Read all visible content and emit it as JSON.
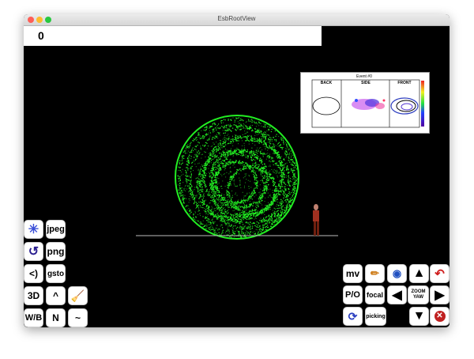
{
  "window": {
    "title": "EsbRootView"
  },
  "counter": {
    "value": "0"
  },
  "inset": {
    "title": "Event #0",
    "labels": {
      "back": "BACK",
      "side": "SIDE",
      "front": "FRONT"
    }
  },
  "left_buttons": {
    "jpeg": "jpeg",
    "png": "png",
    "back": "<)",
    "gsto": "gsto",
    "three_d": "3D",
    "up": "^",
    "wb": "W/B",
    "n": "N",
    "tilde": "~"
  },
  "right_buttons": {
    "mv": "mv",
    "po": "P/O",
    "focal": "focal",
    "zoom": "ZOOM",
    "yaw": "YAW",
    "picking": "picking"
  },
  "colors": {
    "hits": "#22ee22",
    "background": "#000000"
  }
}
